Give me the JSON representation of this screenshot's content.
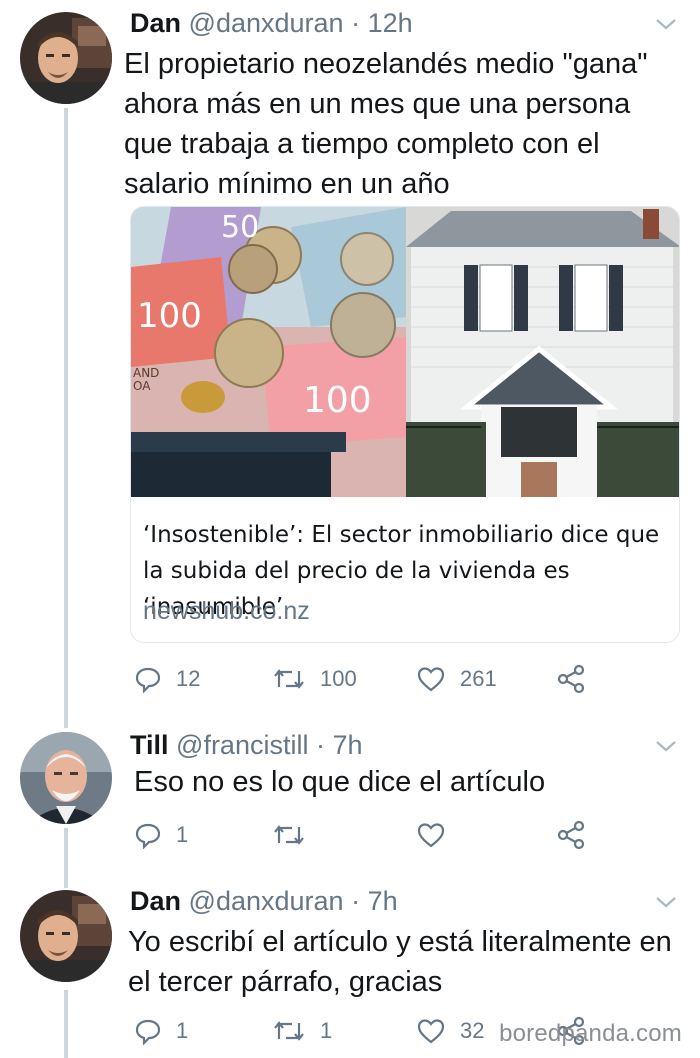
{
  "tweets": [
    {
      "name": "Dan",
      "handle": "@danxduran",
      "time": "12h",
      "text": "El propietario neozelandés medio \"gana\" ahora más en un mes que una persona que trabaja a tiempo completo con el salario mínimo en un año",
      "card": {
        "title": "‘Insostenible’: El sector inmobiliario dice que la subida del precio de la vivienda es ‘inasumible’",
        "domain": "newshub.co.nz"
      },
      "replies": "12",
      "retweets": "100",
      "likes": "261"
    },
    {
      "name": "Till",
      "handle": "@francistill",
      "time": "7h",
      "text": "Eso no es lo que dice el artículo",
      "replies": "1",
      "retweets": "",
      "likes": ""
    },
    {
      "name": "Dan",
      "handle": "@danxduran",
      "time": "7h",
      "text": "Yo escribí el artículo y está literalmente en el tercer párrafo, gracias",
      "replies": "1",
      "retweets": "1",
      "likes": "32"
    }
  ],
  "separator": "·",
  "watermark": "boredpanda.com",
  "icons": [
    "reply-icon",
    "retweet-icon",
    "like-icon",
    "share-icon",
    "chevron-down-icon"
  ],
  "colors": {
    "text": "#14171a",
    "muted": "#657786",
    "thread": "#ccd6dd",
    "border": "#e1e8ed"
  }
}
